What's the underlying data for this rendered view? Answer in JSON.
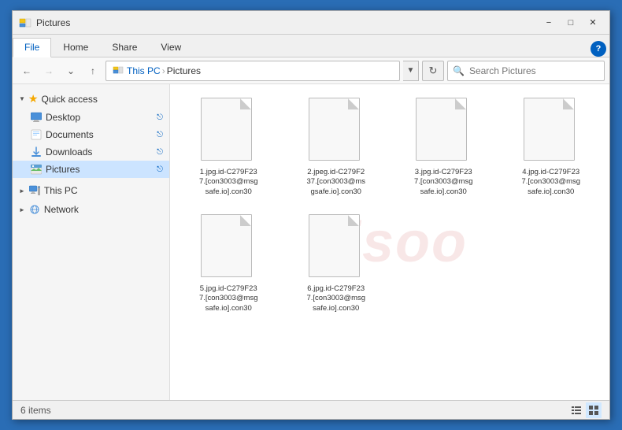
{
  "window": {
    "title": "Pictures",
    "minimize_label": "−",
    "maximize_label": "□",
    "close_label": "✕"
  },
  "ribbon": {
    "tabs": [
      "File",
      "Home",
      "Share",
      "View"
    ],
    "active_tab": "File",
    "help_label": "?"
  },
  "address_bar": {
    "back_disabled": false,
    "forward_disabled": true,
    "up_label": "↑",
    "path_parts": [
      "This PC",
      "Pictures"
    ],
    "refresh_label": "⟳",
    "search_placeholder": "Search Pictures"
  },
  "sidebar": {
    "quick_access_label": "Quick access",
    "items_quick": [
      {
        "label": "Desktop",
        "pinned": true,
        "icon": "desktop"
      },
      {
        "label": "Documents",
        "pinned": true,
        "icon": "documents"
      },
      {
        "label": "Downloads",
        "pinned": true,
        "icon": "downloads"
      },
      {
        "label": "Pictures",
        "pinned": true,
        "icon": "pictures",
        "active": true
      }
    ],
    "this_pc_label": "This PC",
    "network_label": "Network"
  },
  "files": [
    {
      "name": "1.jpg.id-C279F23\n7.[con3003@msg\nsafe.io].con30",
      "selected": false
    },
    {
      "name": "2.jpeg.id-C279F2\n37.[con3003@ms\ngsafe.io].con30",
      "selected": false
    },
    {
      "name": "3.jpg.id-C279F23\n7.[con3003@msg\nsafe.io].con30",
      "selected": false
    },
    {
      "name": "4.jpg.id-C279F23\n7.[con3003@msg\nsafe.io].con30",
      "selected": false
    },
    {
      "name": "5.jpg.id-C279F23\n7.[con3003@msg\nsafe.io].con30",
      "selected": false
    },
    {
      "name": "6.jpg.id-C279F23\n7.[con3003@msg\nsafe.io].con30",
      "selected": false
    }
  ],
  "status_bar": {
    "item_count": "6 items"
  },
  "watermark": {
    "text": "cisoo"
  }
}
